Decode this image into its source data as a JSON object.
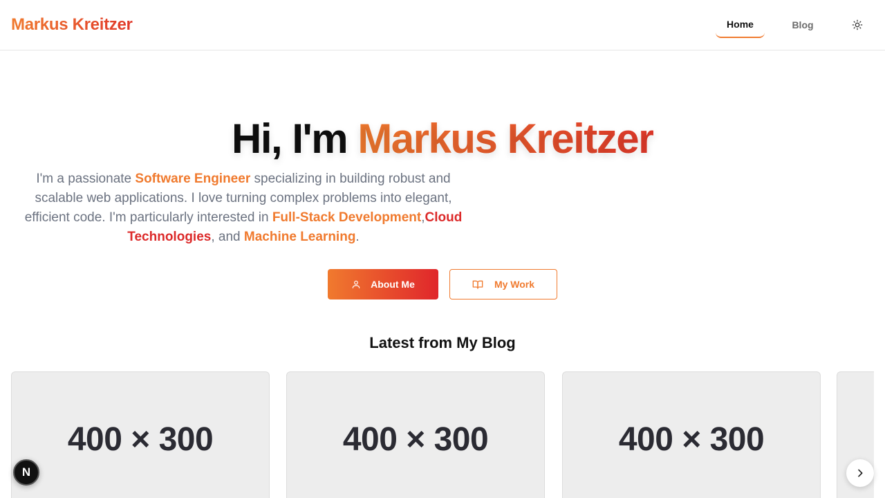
{
  "header": {
    "logo": "Markus Kreitzer",
    "nav": {
      "home": "Home",
      "blog": "Blog"
    },
    "theme_icon": "sun-icon"
  },
  "hero": {
    "greeting": "Hi, I'm",
    "name": "Markus Kreitzer",
    "desc": {
      "p1": "I'm a passionate ",
      "role": "Software Engineer",
      "p2": " specializing in building robust and scalable web applications. I love turning complex problems into elegant, efficient code. I'm particularly interested in ",
      "interest1": "Full-Stack Development",
      "sep1": ",",
      "interest2": "Cloud Technologies",
      "sep2": ", and ",
      "interest3": "Machine Learning",
      "end": "."
    },
    "buttons": {
      "about": "About Me",
      "work": "My Work"
    }
  },
  "blog": {
    "title": "Latest from My Blog",
    "cards": [
      {
        "placeholder": "400 × 300"
      },
      {
        "placeholder": "400 × 300"
      },
      {
        "placeholder": "400 × 300"
      }
    ]
  },
  "dev_badge": "N",
  "colors": {
    "accent_orange": "#f07a2e",
    "accent_red": "#e0382a"
  }
}
